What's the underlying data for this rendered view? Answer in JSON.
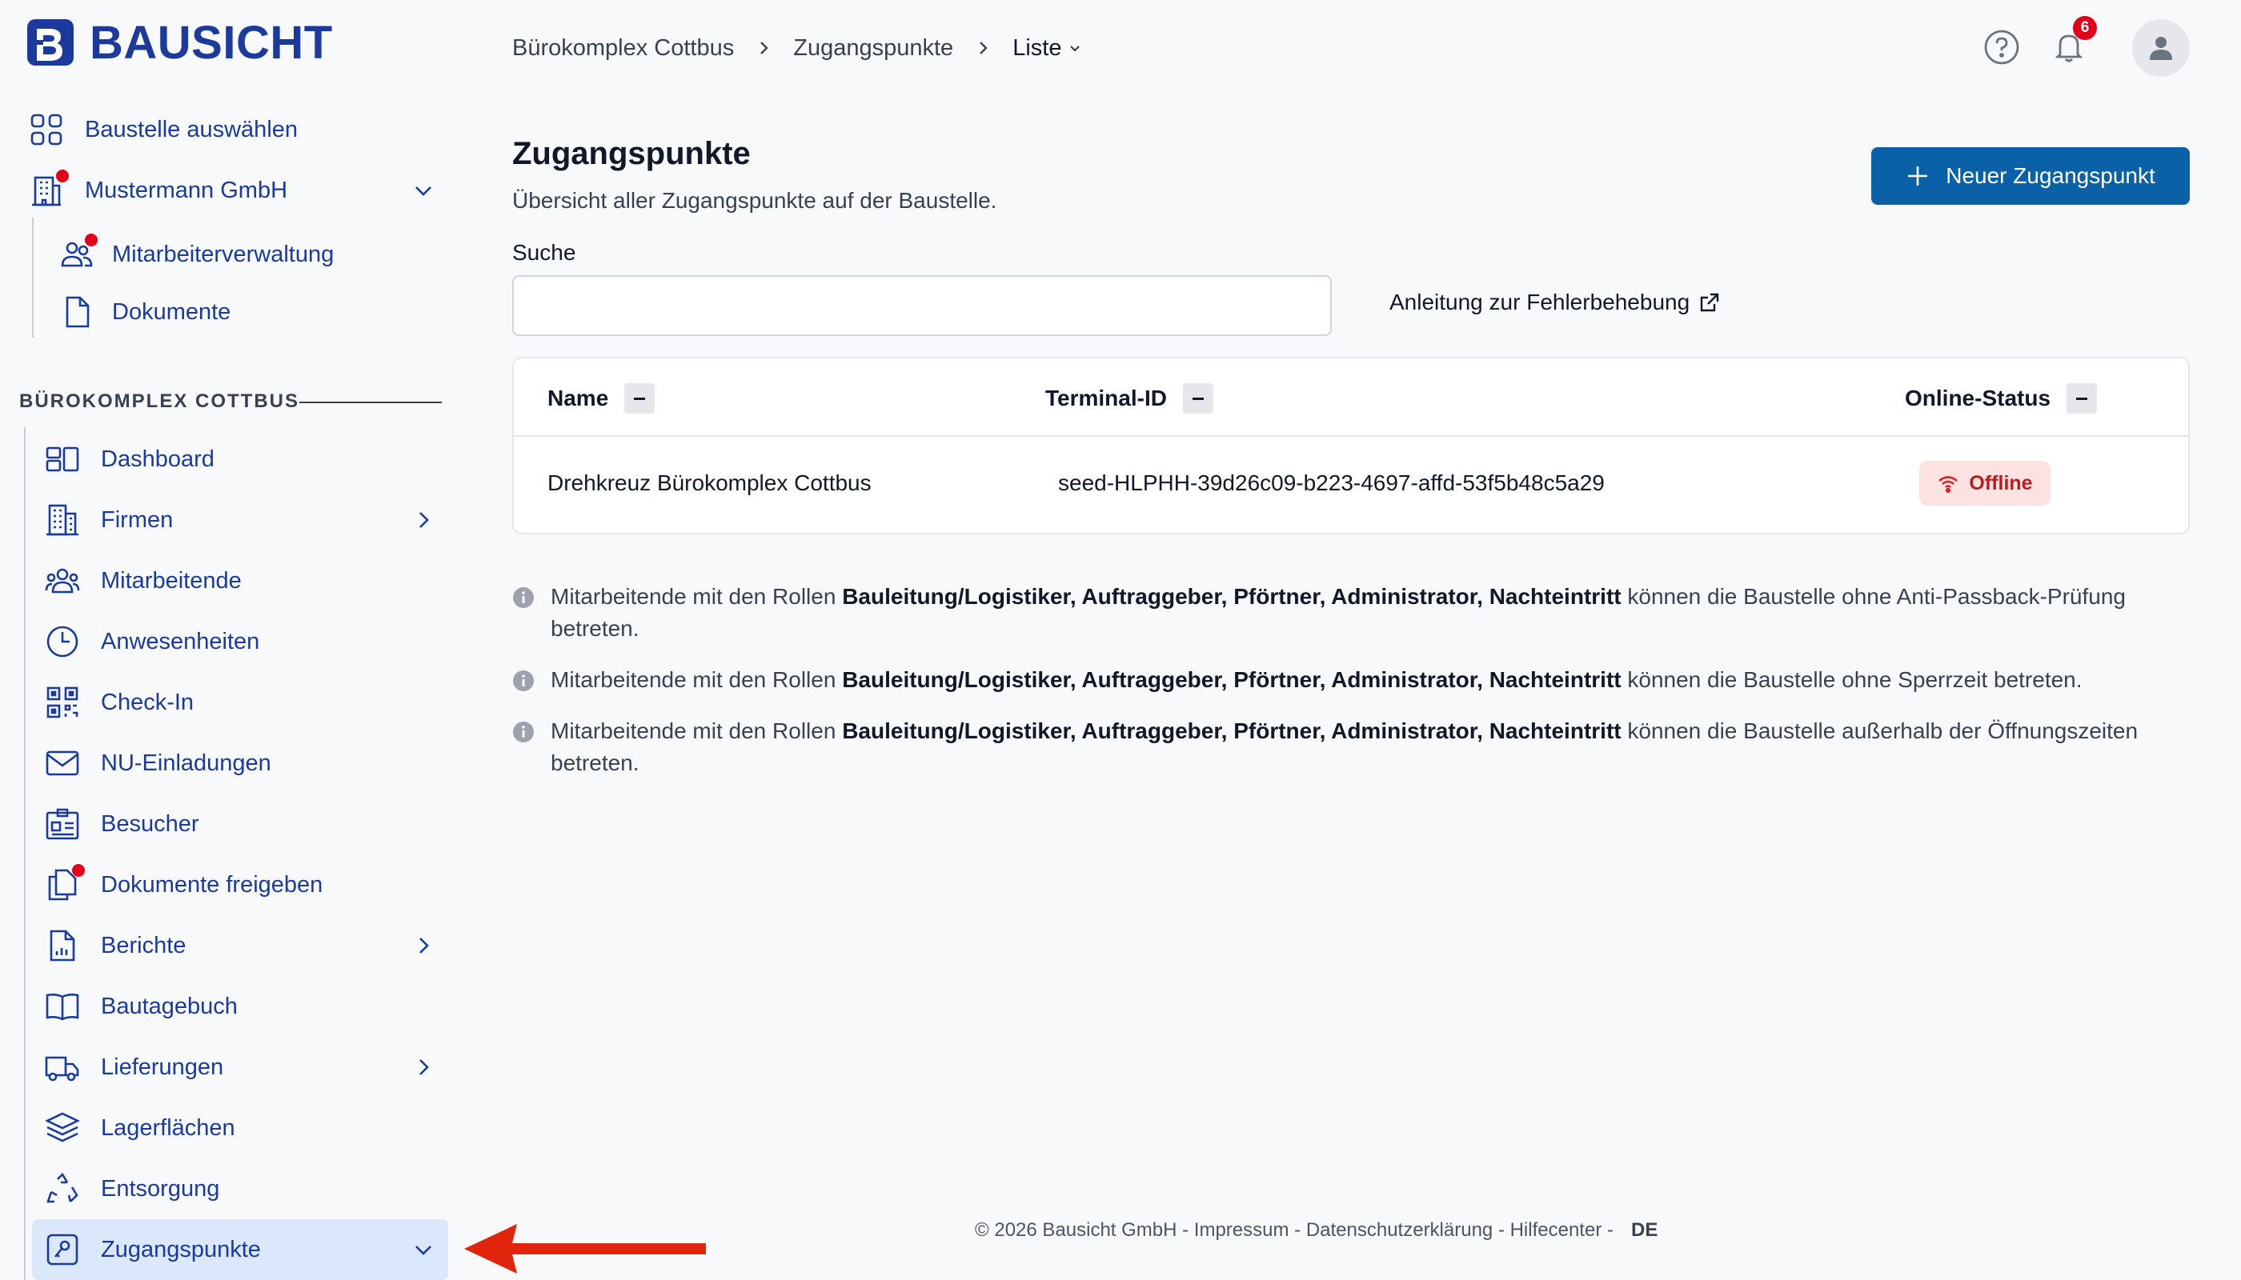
{
  "brand": {
    "name": "BAUSICHT",
    "color": "#1b3a9c"
  },
  "sidebar": {
    "top_items": [
      {
        "label": "Baustelle auswählen",
        "icon": "grid-icon"
      },
      {
        "label": "Mustermann GmbH",
        "icon": "building-icon",
        "notification_dot": true
      },
      {
        "label": "Mitarbeiterverwaltung",
        "icon": "users-icon",
        "notification_dot": true
      },
      {
        "label": "Dokumente",
        "icon": "document-icon"
      }
    ],
    "section_title": "BÜROKOMPLEX COTTBUS",
    "items": [
      {
        "label": "Dashboard",
        "icon": "dashboard-icon"
      },
      {
        "label": "Firmen",
        "icon": "office-building-icon"
      },
      {
        "label": "Mitarbeitende",
        "icon": "user-group-icon"
      },
      {
        "label": "Anwesenheiten",
        "icon": "clock-icon"
      },
      {
        "label": "Check-In",
        "icon": "qr-code-icon"
      },
      {
        "label": "NU-Einladungen",
        "icon": "envelope-icon"
      },
      {
        "label": "Besucher",
        "icon": "id-card-icon"
      },
      {
        "label": "Dokumente freigeben",
        "icon": "documents-icon",
        "notification_dot": true
      },
      {
        "label": "Berichte",
        "icon": "report-icon"
      },
      {
        "label": "Bautagebuch",
        "icon": "book-icon"
      },
      {
        "label": "Lieferungen",
        "icon": "truck-icon"
      },
      {
        "label": "Lagerflächen",
        "icon": "stack-icon"
      },
      {
        "label": "Entsorgung",
        "icon": "recycle-icon"
      },
      {
        "label": "Zugangspunkte",
        "icon": "access-point-icon",
        "active": true
      }
    ]
  },
  "breadcrumb": [
    "Bürokomplex Cottbus",
    "Zugangspunkte",
    "Liste"
  ],
  "header": {
    "notification_count": "6"
  },
  "page": {
    "title": "Zugangspunkte",
    "subtitle": "Übersicht aller Zugangspunkte auf der Baustelle.",
    "new_button": "Neuer Zugangspunkt",
    "search_label": "Suche",
    "search_value": "",
    "help_link": "Anleitung zur Fehlerbehebung"
  },
  "table": {
    "columns": [
      "Name",
      "Terminal-ID",
      "Online-Status"
    ],
    "rows": [
      {
        "name": "Drehkreuz Bürokomplex Cottbus",
        "terminal_id": "seed-HLPHH-39d26c09-b223-4697-affd-53f5b48c5a29",
        "status": "Offline"
      }
    ]
  },
  "notes": [
    {
      "prefix": "Mitarbeitende mit den Rollen ",
      "roles": "Bauleitung/Logistiker, Auftraggeber, Pförtner, Administrator, Nachteintritt",
      "suffix": " können die Baustelle ohne Anti-Passback-Prüfung betreten."
    },
    {
      "prefix": "Mitarbeitende mit den Rollen ",
      "roles": "Bauleitung/Logistiker, Auftraggeber, Pförtner, Administrator, Nachteintritt",
      "suffix": " können die Baustelle ohne Sperrzeit betreten."
    },
    {
      "prefix": "Mitarbeitende mit den Rollen ",
      "roles": "Bauleitung/Logistiker, Auftraggeber, Pförtner, Administrator, Nachteintritt",
      "suffix": " können die Baustelle außerhalb der Öffnungszeiten betreten."
    }
  ],
  "footer": {
    "text": "© 2026 Bausicht GmbH - Impressum - Datenschutzerklärung - Hilfecenter -",
    "language": "DE"
  },
  "colors": {
    "accent": "#0b61a8",
    "nav_text": "#1a3aa0",
    "offline_bg": "#fde2e2",
    "offline_text": "#b91c1c",
    "active_bg": "#dbe7fb",
    "annotation_arrow": "#e0250c"
  }
}
